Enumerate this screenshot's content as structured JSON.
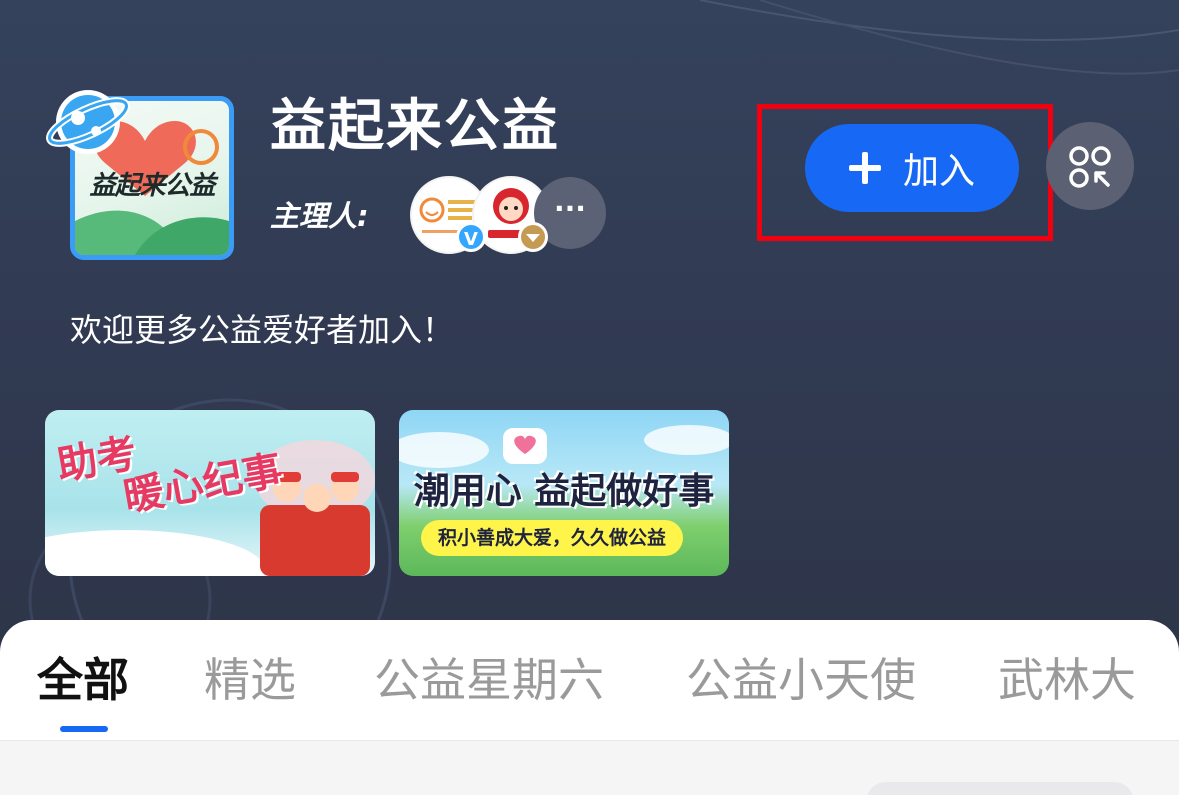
{
  "circle": {
    "avatar_text": "益起来公益",
    "title": "益起来公益",
    "host_label": "主理人:",
    "hosts": [
      {
        "badge": "V",
        "icon": "charity-logo-avatar"
      },
      {
        "badge": "",
        "icon": "free-lunch-logo-avatar"
      }
    ],
    "more_hosts": "···",
    "welcome": "欢迎更多公益爱好者加入！"
  },
  "actions": {
    "join_label": "加入",
    "apps_icon": "apps-grid-icon"
  },
  "banners": [
    {
      "title_line1": "助考",
      "title_line2": "暖心纪事"
    },
    {
      "title": "潮用心 益起做好事",
      "subtitle": "积小善成大爱，久久做公益"
    }
  ],
  "tabs": [
    {
      "label": "全部",
      "active": true
    },
    {
      "label": "精选",
      "active": false
    },
    {
      "label": "公益星期六",
      "active": false
    },
    {
      "label": "公益小天使",
      "active": false
    },
    {
      "label": "武林大",
      "active": false
    }
  ],
  "colors": {
    "accent": "#1769f5",
    "highlight": "#f2000f",
    "hero_bg": "#313b53"
  }
}
